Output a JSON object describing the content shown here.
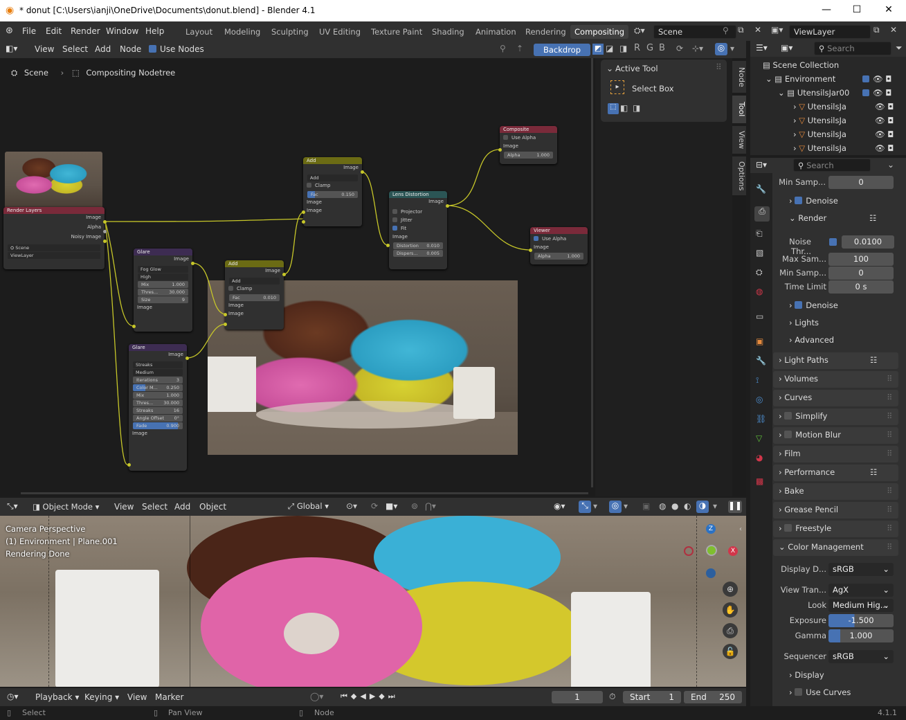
{
  "window": {
    "title": "* donut [C:\\Users\\ianji\\OneDrive\\Documents\\donut.blend] - Blender 4.1"
  },
  "menu": [
    "File",
    "Edit",
    "Render",
    "Window",
    "Help"
  ],
  "workspaces": [
    "Layout",
    "Modeling",
    "Sculpting",
    "UV Editing",
    "Texture Paint",
    "Shading",
    "Animation",
    "Rendering",
    "Compositing"
  ],
  "scene": "Scene",
  "view_layer": "ViewLayer",
  "node_header": {
    "items": [
      "View",
      "Select",
      "Add",
      "Node"
    ],
    "use_nodes": "Use Nodes",
    "backdrop": "Backdrop",
    "channels": [
      "R",
      "G",
      "B"
    ]
  },
  "breadcrumb": {
    "scene": "Scene",
    "tree": "Compositing Nodetree"
  },
  "npanel": {
    "section": "Active Tool",
    "tool": "Select Box"
  },
  "vtabs": [
    "Node",
    "Tool",
    "View",
    "Options"
  ],
  "nodes": {
    "render_layers": {
      "title": "Render Layers",
      "out1": "Image",
      "out2": "Alpha",
      "out3": "Noisy Image",
      "scene": "Scene",
      "layer": "ViewLayer"
    },
    "glare1": {
      "title": "Glare",
      "out": "Image",
      "type": "Fog Glow",
      "quality": "High",
      "mix": "Mix",
      "mix_v": "1.000",
      "thres": "Thres...",
      "thres_v": "30.000",
      "size": "Size",
      "size_v": "9",
      "in": "Image"
    },
    "glare2": {
      "title": "Glare",
      "out": "Image",
      "type": "Streaks",
      "quality": "Medium",
      "iter": "Iterations",
      "iter_v": "3",
      "cm": "Color M...",
      "cm_v": "0.250",
      "mix": "Mix",
      "mix_v": "1.000",
      "thres": "Thres...",
      "thres_v": "30.000",
      "streaks": "Streaks",
      "streaks_v": "16",
      "angle": "Angle Offset",
      "angle_v": "0°",
      "fade": "Fade",
      "fade_v": "0.900",
      "fade_p": 0.9,
      "in": "Image"
    },
    "add1": {
      "title": "Add",
      "out": "Image",
      "mode": "Add",
      "clamp": "Clamp",
      "fac": "Fac",
      "fac_v": "0.150",
      "in1": "Image",
      "in2": "Image"
    },
    "add2": {
      "title": "Add",
      "out": "Image",
      "mode": "Add",
      "clamp": "Clamp",
      "fac": "Fac",
      "fac_v": "0.010",
      "in1": "Image",
      "in2": "Image"
    },
    "lens": {
      "title": "Lens Distortion",
      "out": "Image",
      "proj": "Projector",
      "jitter": "Jitter",
      "fit": "Fit",
      "in": "Image",
      "dist": "Distortion",
      "dist_v": "0.010",
      "disp": "Dispers...",
      "disp_v": "0.005"
    },
    "composite": {
      "title": "Composite",
      "use_alpha": "Use Alpha",
      "in": "Image",
      "alpha": "Alpha",
      "alpha_v": "1.000"
    },
    "viewer": {
      "title": "Viewer",
      "use_alpha": "Use Alpha",
      "in": "Image",
      "alpha": "Alpha",
      "alpha_v": "1.000"
    }
  },
  "viewport_header": {
    "mode": "Object Mode",
    "items": [
      "View",
      "Select",
      "Add",
      "Object"
    ],
    "orient": "Global"
  },
  "viewport_overlay": [
    "Camera Perspective",
    "(1) Environment | Plane.001",
    "Rendering Done"
  ],
  "timeline": {
    "items": [
      "Playback",
      "Keying",
      "View",
      "Marker"
    ],
    "frame": "1",
    "start_label": "Start",
    "start": "1",
    "end_label": "End",
    "end": "250"
  },
  "status": {
    "select": "Select",
    "pan": "Pan View",
    "node": "Node",
    "version": "4.1.1"
  },
  "outliner": {
    "search": "Search",
    "root": "Scene Collection",
    "items": [
      "Environment",
      "UtensilsJar00",
      "UtensilsJa",
      "UtensilsJa",
      "UtensilsJa",
      "UtensilsJa"
    ]
  },
  "props": {
    "search": "Search",
    "min_samp_top": {
      "label": "Min Samp...",
      "value": "0"
    },
    "denoise1": "Denoise",
    "render": "Render",
    "noise_thr": {
      "label": "Noise Thr...",
      "value": "0.0100"
    },
    "max_sam": {
      "label": "Max Sam...",
      "value": "100"
    },
    "min_samp": {
      "label": "Min Samp...",
      "value": "0"
    },
    "time_limit": {
      "label": "Time Limit",
      "value": "0 s"
    },
    "denoise2": "Denoise",
    "lights": "Lights",
    "advanced": "Advanced",
    "panels": [
      "Light Paths",
      "Volumes",
      "Curves",
      "Simplify",
      "Motion Blur",
      "Film",
      "Performance",
      "Bake",
      "Grease Pencil",
      "Freestyle",
      "Color Management"
    ],
    "display_device": {
      "label": "Display D...",
      "value": "sRGB"
    },
    "view_transform": {
      "label": "View Tran...",
      "value": "AgX"
    },
    "look": {
      "label": "Look",
      "value": "Medium Hig..."
    },
    "exposure": {
      "label": "Exposure",
      "value": "-1.500"
    },
    "gamma": {
      "label": "Gamma",
      "value": "1.000"
    },
    "sequencer": {
      "label": "Sequencer",
      "value": "sRGB"
    },
    "display": "Display",
    "use_curves": "Use Curves"
  },
  "colors": {
    "accent": "#4772b3",
    "node_wire": "#c7c729",
    "glare_header": "#3d2c52",
    "add_header": "#6b6b14",
    "lens_header": "#2b5555",
    "output_header": "#7a2a3a"
  }
}
